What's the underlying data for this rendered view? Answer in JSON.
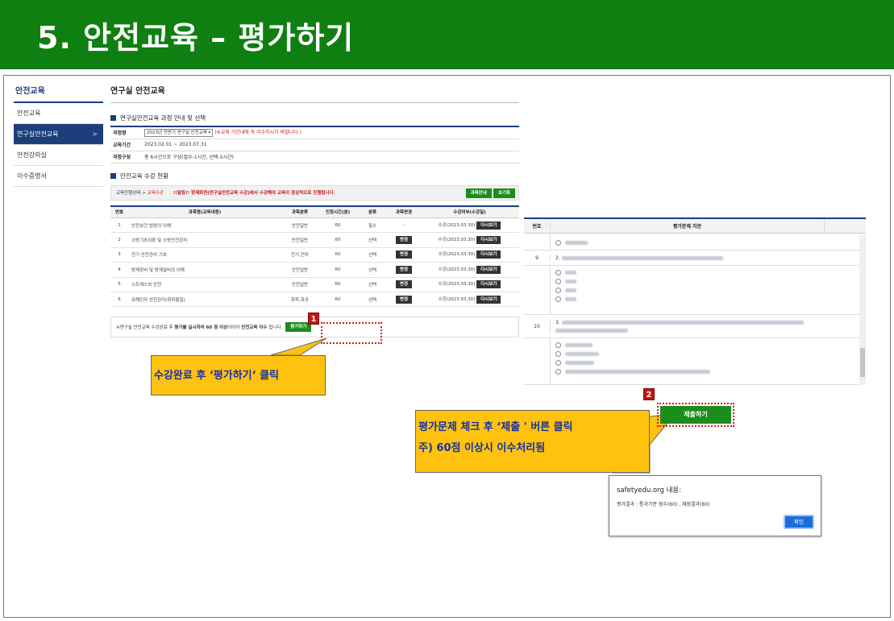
{
  "banner": {
    "title": "5. 안전교육 – 평가하기"
  },
  "side": {
    "title": "안전교육",
    "items": [
      {
        "label": "안전교육"
      },
      {
        "label": "연구실안전교육"
      },
      {
        "label": "안전강의실"
      },
      {
        "label": "이수증명서"
      }
    ]
  },
  "main": {
    "title": "연구실 안전교육",
    "section1": "연구실안전교육 과정 안내 및 선택",
    "info": {
      "course_key": "과정명",
      "course_value": "2023년 전반기 연구실 안전교육",
      "course_note": "(※교육 기간내에 꼭 이수하시기 바랍니다.)",
      "period_key": "교육기간",
      "period_value": "2023.02.01 ~ 2023.07.31",
      "comp_key": "과정구성",
      "comp_value": "총 6시간으로 구성(필수-1시간, 선택-5시간)"
    },
    "section2": "안전교육 수강 현황",
    "status": {
      "path": "교육진행상태 >",
      "path_current": "교육수강",
      "warning": "!!알림!! 현재화면(연구실안전교육 수강)에서 수강해야 교육이 정상적으로 진행됩니다.",
      "btn_info": "과목안내",
      "btn_reset": "초기화"
    },
    "table": {
      "headers": [
        "번호",
        "과목명(교육내용)",
        "과목분류",
        "인정시간(분)",
        "분류",
        "과목변경",
        "수강여부(수강일)"
      ],
      "rows": [
        {
          "no": "1",
          "name": "안전보건 법령의 이해",
          "cat": "안전일반",
          "min": "60",
          "type": "필수",
          "change": "-",
          "date": "수강(2023.03.30)",
          "btn": "다시보기"
        },
        {
          "no": "2",
          "name": "소방기초이론 및 소방안전관리",
          "cat": "안전일반",
          "min": "60",
          "type": "선택",
          "change": "변경",
          "date": "수강(2023.03.30)",
          "btn": "다시보기"
        },
        {
          "no": "3",
          "name": "전기 안전관리 기초",
          "cat": "전기,전자",
          "min": "60",
          "type": "선택",
          "change": "변경",
          "date": "수강(2023.03.30)",
          "btn": "다시보기"
        },
        {
          "no": "4",
          "name": "방재장비 및 방재설비의 이해",
          "cat": "안전일반",
          "min": "60",
          "type": "선택",
          "change": "변경",
          "date": "수강(2023.03.30)",
          "btn": "다시보기"
        },
        {
          "no": "5",
          "name": "스트레스와 안전",
          "cat": "안전일반",
          "min": "60",
          "type": "선택",
          "change": "변경",
          "date": "수강(2023.03.30)",
          "btn": "다시보기"
        },
        {
          "no": "6",
          "name": "유해인자 안전관리(화학물질)",
          "cat": "화학,화공",
          "min": "60",
          "type": "선택",
          "change": "변경",
          "date": "수강(2023.03.30)",
          "btn": "다시보기"
        }
      ]
    },
    "footnote": {
      "pre": "※연구실 안전교육 수강완료 후",
      "bold1": "평가를 실시하여 60 점 이상",
      "mid": "이어야",
      "bold2": "안전교육 이수",
      "post": "됩니다.",
      "eval_btn": "평가하기"
    }
  },
  "badges": {
    "one": "1",
    "two": "2"
  },
  "callouts": {
    "c1": "수강완료 후 ‘평가하기‘ 클릭",
    "c2_line1": "평가문제 체크 후 ‘제출 ' 버른 클릭",
    "c2_line2": "주) 60점 이상시 이수처리됨"
  },
  "questions": {
    "head_no": "번호",
    "head_q": "평가문제 지문",
    "q9": "9",
    "q9_prefix": "2.",
    "q10": "10",
    "q10_prefix": "3."
  },
  "submit_btn": "제출하기",
  "dialog": {
    "title": "safetyedu.org 내용:",
    "message": "평가결과 : 통과기준 점수(60) , 채점결과(80)",
    "ok": "확인"
  }
}
